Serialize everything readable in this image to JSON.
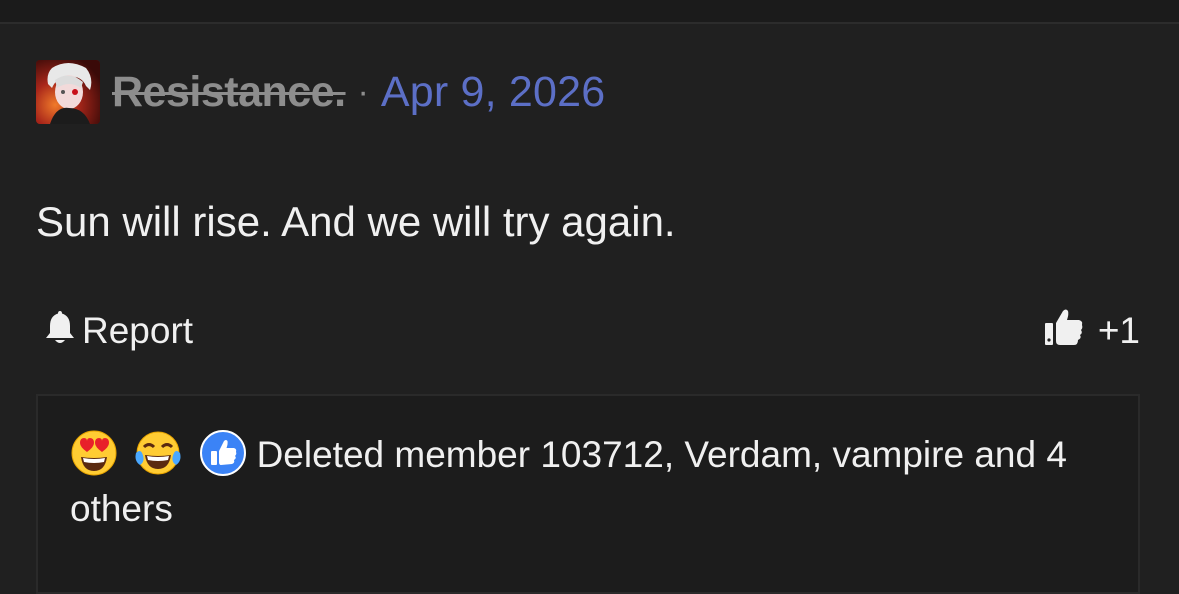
{
  "post": {
    "username": "Resistance.",
    "separator": "·",
    "date": "Apr 9, 2026",
    "message": "Sun will rise. And we will try again."
  },
  "actions": {
    "report_label": "Report",
    "like_count": "+1"
  },
  "reactions": {
    "icons": [
      "heart-eyes-emoji",
      "tears-of-joy-emoji",
      "thumbs-up-reaction"
    ],
    "summary": "Deleted member 103712, Verdam, vampire and 4 others"
  },
  "colors": {
    "background": "#202020",
    "username": "#8d8d8d",
    "date_link": "#5c6fc6",
    "text": "#f0f0f0",
    "like_blue": "#3b83f6"
  }
}
